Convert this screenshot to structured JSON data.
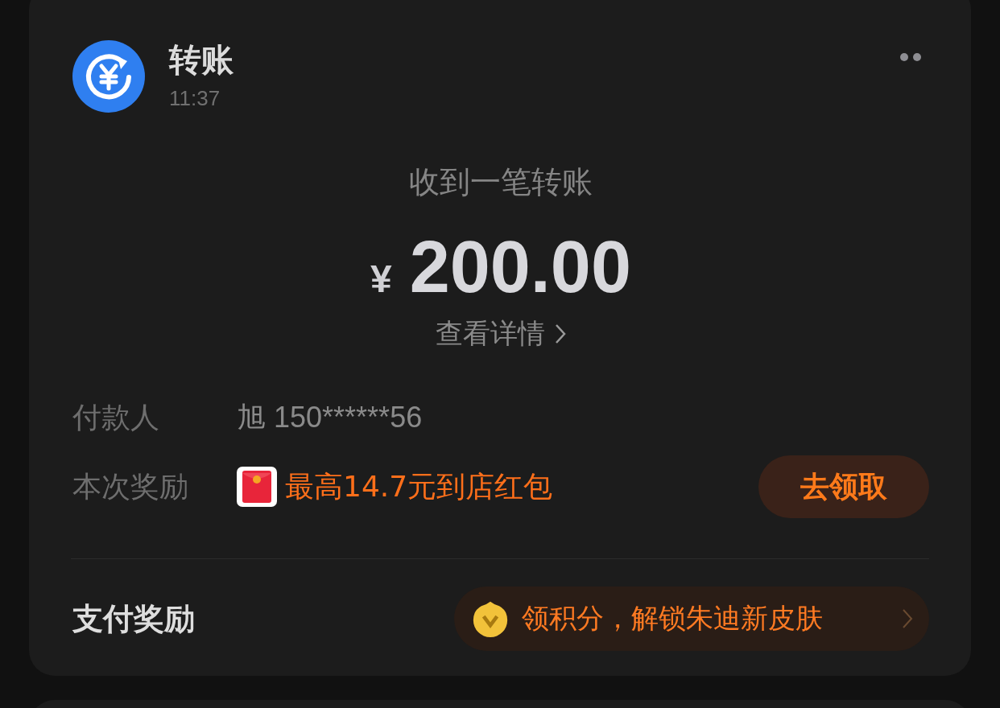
{
  "header": {
    "title": "转账",
    "time": "11:37"
  },
  "transfer": {
    "heading": "收到一笔转账",
    "currency": "¥",
    "amount": "200.00",
    "details_link": "查看详情"
  },
  "rows": [
    {
      "kind": "text",
      "label": "付款人",
      "value": "旭 150******56"
    },
    {
      "kind": "reward",
      "label": "本次奖励",
      "value": "最高14.7元到店红包",
      "action": "去领取"
    }
  ],
  "footer": {
    "label": "支付奖励",
    "promo": "领积分，解锁朱迪新皮肤"
  }
}
